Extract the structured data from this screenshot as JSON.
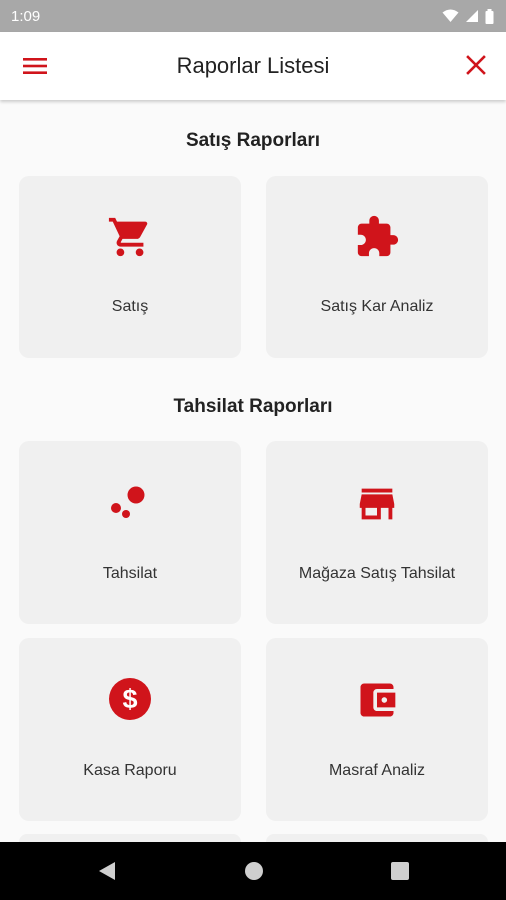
{
  "status_bar": {
    "time": "1:09"
  },
  "app_bar": {
    "title": "Raporlar Listesi",
    "menu_icon": "menu-icon",
    "close_icon": "close-icon"
  },
  "sections": [
    {
      "title": "Satış Raporları"
    },
    {
      "title": "Tahsilat Raporları"
    }
  ],
  "cards": [
    {
      "label": "Satış",
      "icon": "cart-icon"
    },
    {
      "label": "Satış Kar Analiz",
      "icon": "puzzle-icon"
    },
    {
      "label": "Tahsilat",
      "icon": "bubbles-icon"
    },
    {
      "label": "Mağaza Satış Tahsilat",
      "icon": "store-icon"
    },
    {
      "label": "Kasa Raporu",
      "icon": "dollar-icon"
    },
    {
      "label": "Masraf Analiz",
      "icon": "wallet-icon"
    }
  ],
  "colors": {
    "accent": "#d0141b",
    "card_bg": "#f0f0f0",
    "status_bar_bg": "#a8a8a8",
    "nav_bar_bg": "#000000"
  }
}
